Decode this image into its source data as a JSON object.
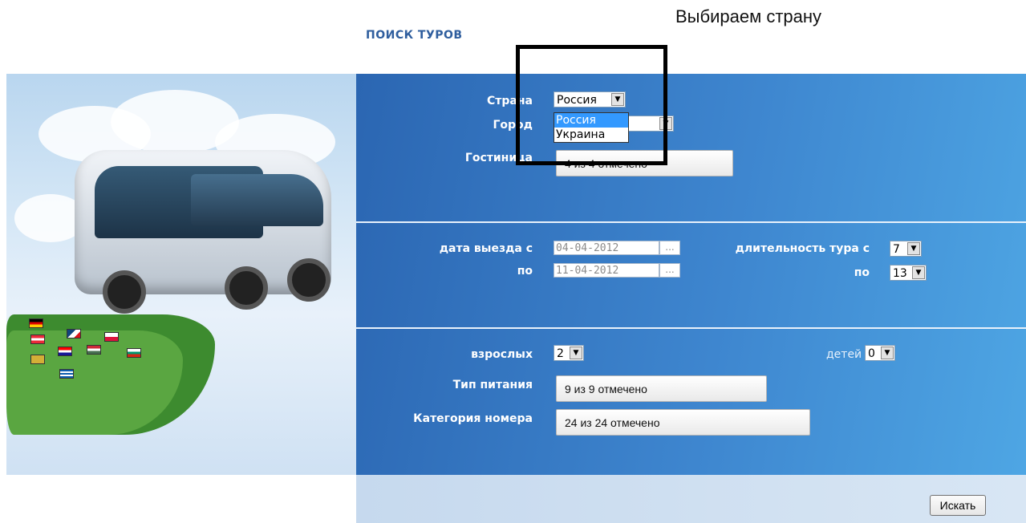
{
  "annotation": {
    "title": "Выбираем страну"
  },
  "page": {
    "title": "ПОИСК ТУРОВ"
  },
  "form": {
    "country": {
      "label": "Страна",
      "value": "Россия",
      "options": [
        "Россия",
        "Украина"
      ],
      "highlighted": "Россия"
    },
    "city": {
      "label": "Город",
      "value": ""
    },
    "hotel": {
      "label": "Гостиница",
      "value": "4 из 4 отмечено"
    },
    "depart_from": {
      "label": "дата выезда с",
      "value": "04-04-2012",
      "button": "..."
    },
    "depart_to": {
      "label": "по",
      "value": "11-04-2012",
      "button": "..."
    },
    "duration_from": {
      "label": "длительность тура с",
      "value": "7"
    },
    "duration_to": {
      "label": "по",
      "value": "13"
    },
    "adults": {
      "label": "взрослых",
      "value": "2"
    },
    "children": {
      "label": "детей",
      "value": "0"
    },
    "meal": {
      "label": "Тип питания",
      "value": "9 из 9 отмечено"
    },
    "room": {
      "label": "Категория номера",
      "value": "24 из 24 отмечено"
    }
  },
  "actions": {
    "search_label": "Искать"
  },
  "colors": {
    "panel_start": "#2b66b2",
    "panel_end": "#4ea6e4",
    "title": "#2f5e9e",
    "highlight": "#3399ff"
  }
}
